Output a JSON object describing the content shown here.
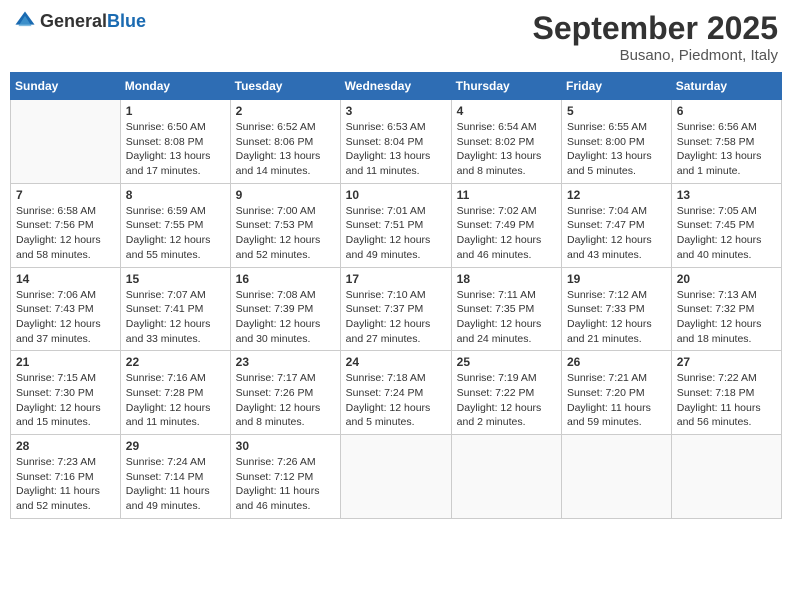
{
  "header": {
    "logo_general": "General",
    "logo_blue": "Blue",
    "month_title": "September 2025",
    "subtitle": "Busano, Piedmont, Italy"
  },
  "weekdays": [
    "Sunday",
    "Monday",
    "Tuesday",
    "Wednesday",
    "Thursday",
    "Friday",
    "Saturday"
  ],
  "weeks": [
    [
      {
        "day": "",
        "info": ""
      },
      {
        "day": "1",
        "info": "Sunrise: 6:50 AM\nSunset: 8:08 PM\nDaylight: 13 hours\nand 17 minutes."
      },
      {
        "day": "2",
        "info": "Sunrise: 6:52 AM\nSunset: 8:06 PM\nDaylight: 13 hours\nand 14 minutes."
      },
      {
        "day": "3",
        "info": "Sunrise: 6:53 AM\nSunset: 8:04 PM\nDaylight: 13 hours\nand 11 minutes."
      },
      {
        "day": "4",
        "info": "Sunrise: 6:54 AM\nSunset: 8:02 PM\nDaylight: 13 hours\nand 8 minutes."
      },
      {
        "day": "5",
        "info": "Sunrise: 6:55 AM\nSunset: 8:00 PM\nDaylight: 13 hours\nand 5 minutes."
      },
      {
        "day": "6",
        "info": "Sunrise: 6:56 AM\nSunset: 7:58 PM\nDaylight: 13 hours\nand 1 minute."
      }
    ],
    [
      {
        "day": "7",
        "info": "Sunrise: 6:58 AM\nSunset: 7:56 PM\nDaylight: 12 hours\nand 58 minutes."
      },
      {
        "day": "8",
        "info": "Sunrise: 6:59 AM\nSunset: 7:55 PM\nDaylight: 12 hours\nand 55 minutes."
      },
      {
        "day": "9",
        "info": "Sunrise: 7:00 AM\nSunset: 7:53 PM\nDaylight: 12 hours\nand 52 minutes."
      },
      {
        "day": "10",
        "info": "Sunrise: 7:01 AM\nSunset: 7:51 PM\nDaylight: 12 hours\nand 49 minutes."
      },
      {
        "day": "11",
        "info": "Sunrise: 7:02 AM\nSunset: 7:49 PM\nDaylight: 12 hours\nand 46 minutes."
      },
      {
        "day": "12",
        "info": "Sunrise: 7:04 AM\nSunset: 7:47 PM\nDaylight: 12 hours\nand 43 minutes."
      },
      {
        "day": "13",
        "info": "Sunrise: 7:05 AM\nSunset: 7:45 PM\nDaylight: 12 hours\nand 40 minutes."
      }
    ],
    [
      {
        "day": "14",
        "info": "Sunrise: 7:06 AM\nSunset: 7:43 PM\nDaylight: 12 hours\nand 37 minutes."
      },
      {
        "day": "15",
        "info": "Sunrise: 7:07 AM\nSunset: 7:41 PM\nDaylight: 12 hours\nand 33 minutes."
      },
      {
        "day": "16",
        "info": "Sunrise: 7:08 AM\nSunset: 7:39 PM\nDaylight: 12 hours\nand 30 minutes."
      },
      {
        "day": "17",
        "info": "Sunrise: 7:10 AM\nSunset: 7:37 PM\nDaylight: 12 hours\nand 27 minutes."
      },
      {
        "day": "18",
        "info": "Sunrise: 7:11 AM\nSunset: 7:35 PM\nDaylight: 12 hours\nand 24 minutes."
      },
      {
        "day": "19",
        "info": "Sunrise: 7:12 AM\nSunset: 7:33 PM\nDaylight: 12 hours\nand 21 minutes."
      },
      {
        "day": "20",
        "info": "Sunrise: 7:13 AM\nSunset: 7:32 PM\nDaylight: 12 hours\nand 18 minutes."
      }
    ],
    [
      {
        "day": "21",
        "info": "Sunrise: 7:15 AM\nSunset: 7:30 PM\nDaylight: 12 hours\nand 15 minutes."
      },
      {
        "day": "22",
        "info": "Sunrise: 7:16 AM\nSunset: 7:28 PM\nDaylight: 12 hours\nand 11 minutes."
      },
      {
        "day": "23",
        "info": "Sunrise: 7:17 AM\nSunset: 7:26 PM\nDaylight: 12 hours\nand 8 minutes."
      },
      {
        "day": "24",
        "info": "Sunrise: 7:18 AM\nSunset: 7:24 PM\nDaylight: 12 hours\nand 5 minutes."
      },
      {
        "day": "25",
        "info": "Sunrise: 7:19 AM\nSunset: 7:22 PM\nDaylight: 12 hours\nand 2 minutes."
      },
      {
        "day": "26",
        "info": "Sunrise: 7:21 AM\nSunset: 7:20 PM\nDaylight: 11 hours\nand 59 minutes."
      },
      {
        "day": "27",
        "info": "Sunrise: 7:22 AM\nSunset: 7:18 PM\nDaylight: 11 hours\nand 56 minutes."
      }
    ],
    [
      {
        "day": "28",
        "info": "Sunrise: 7:23 AM\nSunset: 7:16 PM\nDaylight: 11 hours\nand 52 minutes."
      },
      {
        "day": "29",
        "info": "Sunrise: 7:24 AM\nSunset: 7:14 PM\nDaylight: 11 hours\nand 49 minutes."
      },
      {
        "day": "30",
        "info": "Sunrise: 7:26 AM\nSunset: 7:12 PM\nDaylight: 11 hours\nand 46 minutes."
      },
      {
        "day": "",
        "info": ""
      },
      {
        "day": "",
        "info": ""
      },
      {
        "day": "",
        "info": ""
      },
      {
        "day": "",
        "info": ""
      }
    ]
  ]
}
